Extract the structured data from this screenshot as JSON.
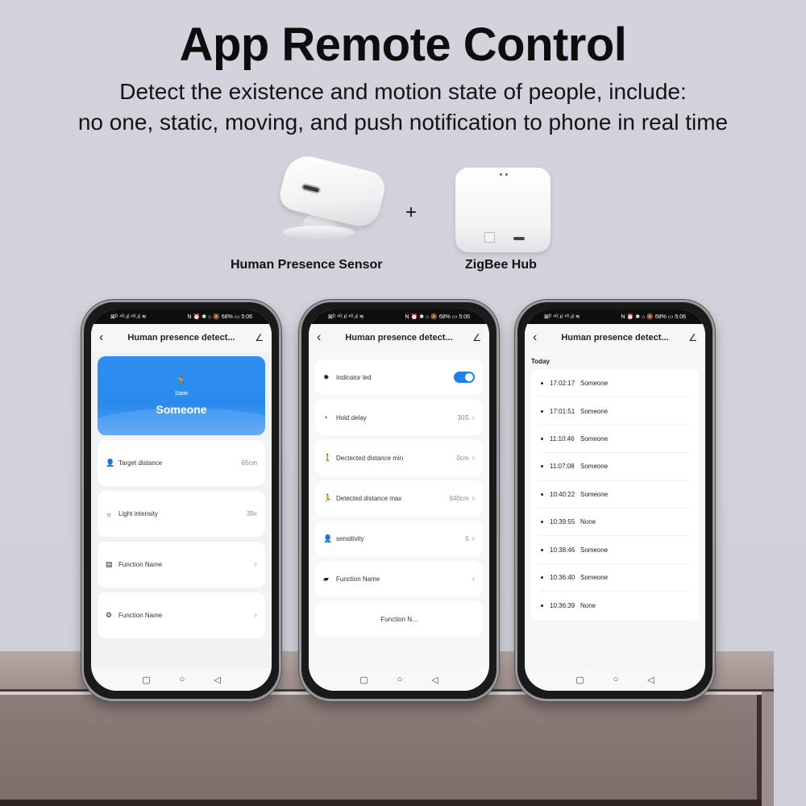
{
  "headline": "App Remote Control",
  "subtitle_lines": [
    "Detect the existence and motion state of people, include:",
    "no one, static, moving, and push notification to phone in real time"
  ],
  "products": {
    "sensor_label": "Human Presence Sensor",
    "plus": "+",
    "hub_label": "ZigBee Hub"
  },
  "statusbar": {
    "left": "⊠ᴰ ⁴ᴳ.ıl ⁴ᴳ.ıl ≋",
    "right": "N ⏰ ✱ ⌂ 🔕 68% ▭ 5:06",
    "battery": "68%",
    "time": "5:06"
  },
  "appbar": {
    "back": "‹",
    "title": "Human presence detect...",
    "edit": "∠"
  },
  "navbar": {
    "recent": "▢",
    "home": "○",
    "back": "◁"
  },
  "phone1": {
    "state_icon": "🏃",
    "state_label": "State",
    "state_value": "Someone",
    "rows": [
      {
        "icon": "person-icon",
        "glyph": "👤",
        "label": "Target distance",
        "value": "65cm"
      },
      {
        "icon": "light-icon",
        "glyph": "☼",
        "label": "Light intensity",
        "value": "39x"
      },
      {
        "icon": "document-icon",
        "glyph": "▤",
        "label": "Function Name",
        "chevron": "›"
      },
      {
        "icon": "gear-icon",
        "glyph": "⚙",
        "label": "Function Name",
        "chevron": "›"
      }
    ]
  },
  "phone2": {
    "rows": [
      {
        "icon": "sun-icon",
        "glyph": "✹",
        "label": "Indicator led",
        "toggle": true
      },
      {
        "icon": "clock-icon",
        "glyph": "◔",
        "label": "Hold delay",
        "value": "30S",
        "chevron": "›"
      },
      {
        "icon": "walk-icon",
        "glyph": "🚶",
        "label": "Dectected distance min",
        "value": "0cm",
        "chevron": "›"
      },
      {
        "icon": "run-icon",
        "glyph": "🏃",
        "label": "Detected distance max",
        "value": "840cm",
        "chevron": "›"
      },
      {
        "icon": "person-icon",
        "glyph": "👤",
        "label": "sensitivity",
        "value": "5",
        "chevron": "›"
      },
      {
        "icon": "chat-icon",
        "glyph": "▰",
        "label": "Function Name",
        "chevron": "›"
      }
    ],
    "bottom_button": "Function N..."
  },
  "phone3": {
    "section": "Today",
    "log": [
      {
        "time": "17:02:17",
        "state": "Someone"
      },
      {
        "time": "17:01:51",
        "state": "Someone"
      },
      {
        "time": "11:10:46",
        "state": "Someone"
      },
      {
        "time": "11:07:08",
        "state": "Someone"
      },
      {
        "time": "10:40:22",
        "state": "Someone"
      },
      {
        "time": "10:39:55",
        "state": "None"
      },
      {
        "time": "10:38:46",
        "state": "Someone"
      },
      {
        "time": "10:36:40",
        "state": "Someone"
      },
      {
        "time": "10:36:39",
        "state": "None"
      }
    ]
  },
  "colors": {
    "accent": "#2a8aee",
    "toggle_on": "#1e7ff0",
    "background": "#d3d3dd"
  }
}
